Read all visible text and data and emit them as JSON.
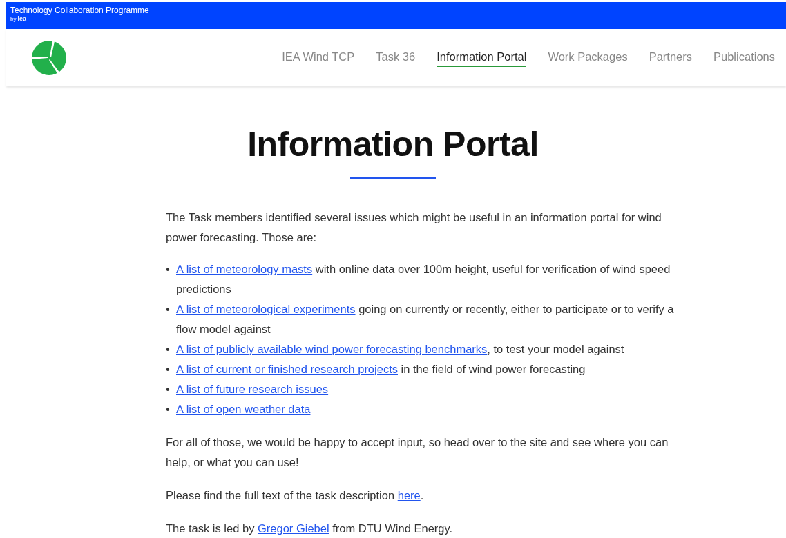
{
  "topbar": {
    "title": "Technology Collaboration Programme",
    "by": "by",
    "brand": "iea"
  },
  "nav": [
    {
      "label": "IEA Wind TCP",
      "selected": false
    },
    {
      "label": "Task 36",
      "selected": false
    },
    {
      "label": "Information Portal",
      "selected": true
    },
    {
      "label": "Work Packages",
      "selected": false
    },
    {
      "label": "Partners",
      "selected": false
    },
    {
      "label": "Publications",
      "selected": false
    }
  ],
  "heading": "Information Portal",
  "intro": "The Task members identified several issues which might be useful in an information portal for wind power forecasting. Those are:",
  "items": [
    {
      "bullet": "•",
      "link": "A list of meteorology masts",
      "text": " with online data over 100m height, useful for verification of wind speed predictions"
    },
    {
      "bullet": "•",
      "link": "A list of meteorological experiments",
      "text": " going on currently or recently, either to participate or to verify a flow model against"
    },
    {
      "bullet": "•",
      "link": "A list of publicly available wind power forecasting benchmarks",
      "text": ", to test your model against"
    },
    {
      "bullet": "•",
      "link": "A list of current or finished research projects",
      "text": " in the field of wind power forecasting"
    },
    {
      "bullet": "•",
      "link": "A list of future research issues"
    },
    {
      "bullet": "•",
      "link": "A list of open weather data"
    }
  ],
  "paragraphs": [
    {
      "before": "For all of those, we would be happy to accept input, so head over to the site and see where you can help, or what you can use!"
    },
    {
      "before": "Please find the full text of the task description ",
      "link": "here",
      "after": "."
    },
    {
      "before": "The task is led by ",
      "link": "Gregor Giebel",
      "after": " from DTU Wind Energy."
    }
  ]
}
